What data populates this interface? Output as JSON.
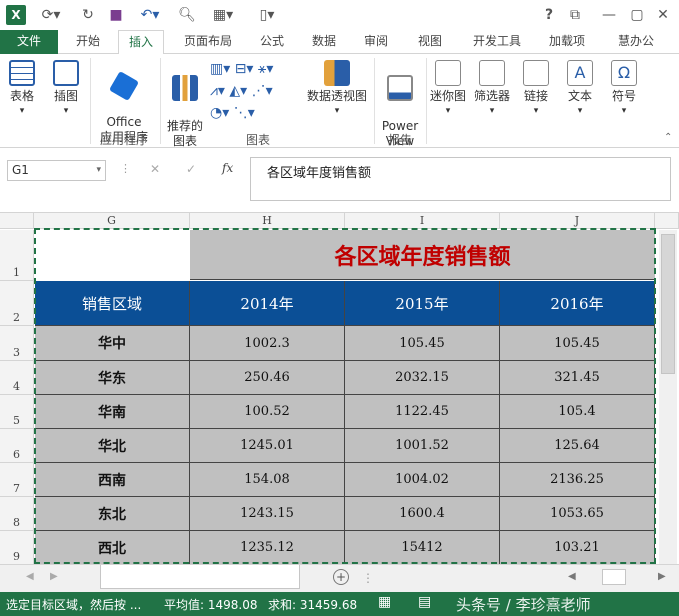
{
  "app": {
    "logo": "X"
  },
  "quick_access": {
    "icons": [
      "excel-logo-icon",
      "save-icon",
      "undo-icon",
      "redo-icon",
      "print-preview-icon",
      "new-icon",
      "more-icon"
    ],
    "help": "?"
  },
  "tabs": [
    {
      "id": "file",
      "label": "文件"
    },
    {
      "id": "home",
      "label": "开始"
    },
    {
      "id": "insert",
      "label": "插入"
    },
    {
      "id": "page-layout",
      "label": "页面布局"
    },
    {
      "id": "formulas",
      "label": "公式"
    },
    {
      "id": "data",
      "label": "数据"
    },
    {
      "id": "review",
      "label": "审阅"
    },
    {
      "id": "view",
      "label": "视图"
    },
    {
      "id": "developer",
      "label": "开发工具"
    },
    {
      "id": "addins",
      "label": "加载项"
    },
    {
      "id": "huibangong",
      "label": "慧办公"
    }
  ],
  "ribbon": {
    "table": "表格",
    "illustrations": "插图",
    "office_apps": "Office\n应用程序",
    "apps_group": "应用程序",
    "recommended_charts": "推荐的\n图表",
    "charts_group": "图表",
    "pivot_chart": "数据透视图",
    "power_view": "Power\nView",
    "report_group": "报告",
    "sparklines": "迷你图",
    "filter": "筛选器",
    "links": "链接",
    "text": "文本",
    "symbols": "符号"
  },
  "formula_bar": {
    "name_box": "G1",
    "cancel": "✕",
    "enter": "✓",
    "fx": "fx",
    "content": "各区域年度销售额"
  },
  "sheet": {
    "columns": [
      "G",
      "H",
      "I",
      "J"
    ],
    "rows": [
      "1",
      "2",
      "3",
      "4",
      "5",
      "6",
      "7",
      "8",
      "9"
    ],
    "title": "各区域年度销售额",
    "headers": [
      "销售区域",
      "2014年",
      "2015年",
      "2016年"
    ],
    "data": [
      [
        "华中",
        "1002.3",
        "105.45",
        "105.45"
      ],
      [
        "华东",
        "250.46",
        "2032.15",
        "321.45"
      ],
      [
        "华南",
        "100.52",
        "1122.45",
        "105.4"
      ],
      [
        "华北",
        "1245.01",
        "1001.52",
        "125.64"
      ],
      [
        "西南",
        "154.08",
        "1004.02",
        "2136.25"
      ],
      [
        "东北",
        "1243.15",
        "1600.4",
        "1053.65"
      ],
      [
        "西北",
        "1235.12",
        "15412",
        "103.21"
      ]
    ]
  },
  "status": {
    "message": "选定目标区域，然后按 ...",
    "average": "平均值: 1498.08",
    "sum": "求和: 31459.68",
    "watermark": "头条号 / 李珍熹老师"
  },
  "colors": {
    "excel_green": "#217346",
    "header_blue": "#0b4f96",
    "title_red": "#c00000",
    "cell_gray": "#c0c0c0"
  }
}
